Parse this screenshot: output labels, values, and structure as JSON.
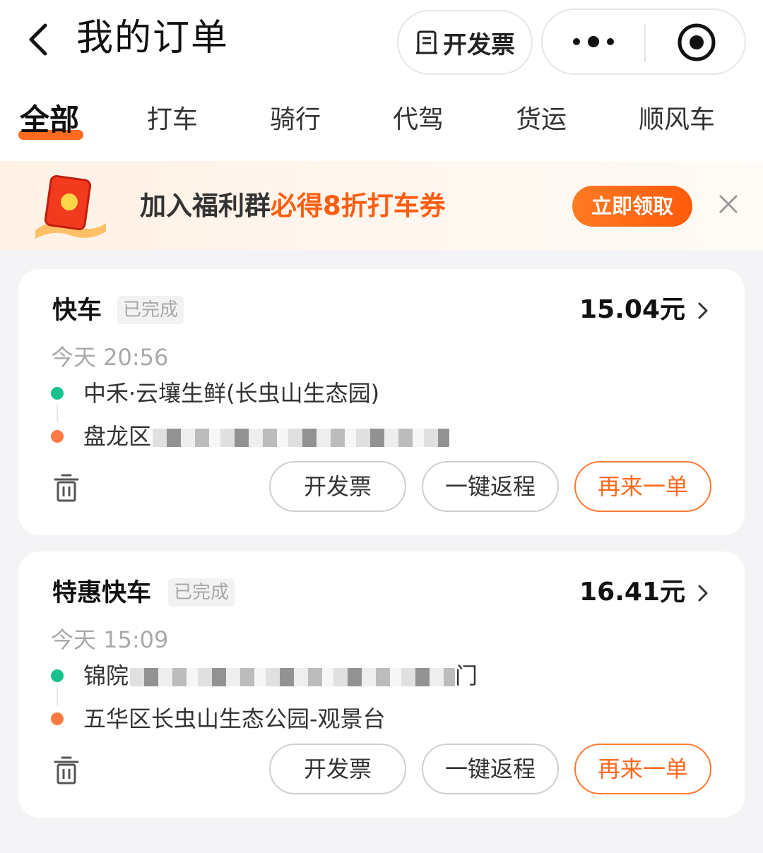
{
  "header": {
    "title": "我的订单",
    "invoice_label": "开发票"
  },
  "tabs": [
    {
      "label": "全部",
      "active": true
    },
    {
      "label": "打车",
      "active": false
    },
    {
      "label": "骑行",
      "active": false
    },
    {
      "label": "代驾",
      "active": false
    },
    {
      "label": "货运",
      "active": false
    },
    {
      "label": "顺风车",
      "active": false
    }
  ],
  "banner": {
    "text_dark": "加入福利群",
    "text_highlight": "必得8折打车券",
    "button_label": "立即领取"
  },
  "orders": [
    {
      "service": "快车",
      "status": "已完成",
      "price": "15.04元",
      "time": "今天 20:56",
      "pickup": "中禾·云壤生鲜(长虫山生态园)",
      "dropoff_visible": "盘龙区",
      "actions": {
        "invoice": "开发票",
        "return": "一键返程",
        "again": "再来一单"
      }
    },
    {
      "service": "特惠快车",
      "status": "已完成",
      "price": "16.41元",
      "time": "今天 15:09",
      "pickup_visible": "锦院",
      "pickup_tail": "门",
      "dropoff": "五华区长虫山生态公园-观景台",
      "actions": {
        "invoice": "开发票",
        "return": "一键返程",
        "again": "再来一单"
      }
    }
  ],
  "colors": {
    "accent": "#ff6a1f",
    "pickup_dot": "#18c28f",
    "dropoff_dot": "#ff7a43"
  }
}
